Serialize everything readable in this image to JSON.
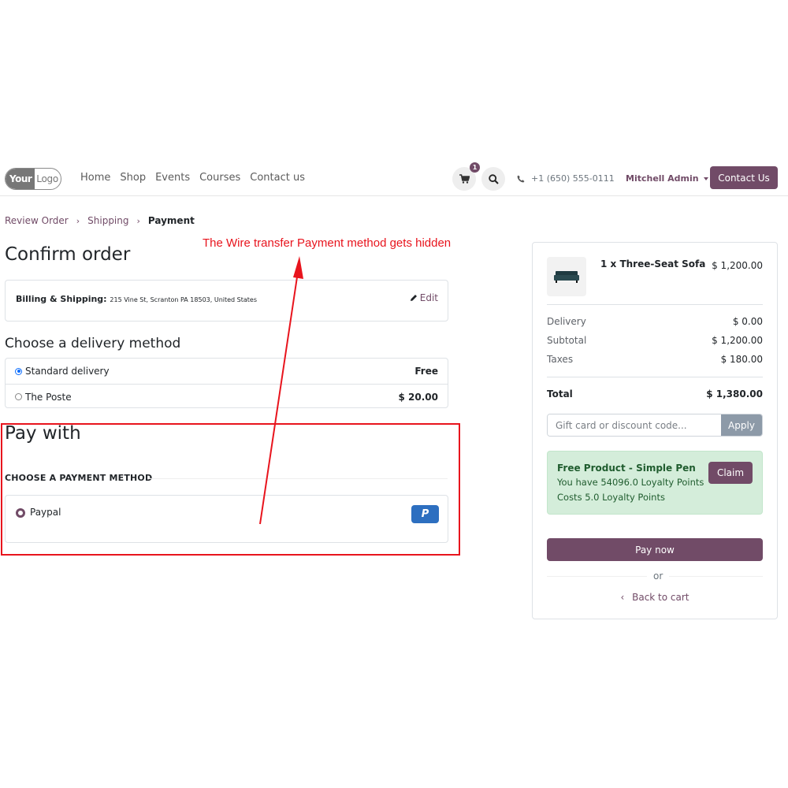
{
  "nav": {
    "logo_part1": "Your",
    "logo_part2": "Logo",
    "links": [
      "Home",
      "Shop",
      "Events",
      "Courses",
      "Contact us"
    ],
    "cart_count": "1",
    "phone": "+1 (650) 555-0111",
    "user": "Mitchell Admin",
    "contact_button": "Contact Us"
  },
  "breadcrumb": {
    "items": [
      "Review Order",
      "Shipping",
      "Payment"
    ],
    "separator": "›"
  },
  "annotation": "The Wire transfer Payment method gets hidden",
  "page_title": "Confirm order",
  "billing": {
    "label": "Billing & Shipping:",
    "address": "215 Vine St, Scranton PA 18503, United States",
    "edit": "Edit"
  },
  "delivery": {
    "title": "Choose a delivery method",
    "options": [
      {
        "label": "Standard delivery",
        "price": "Free",
        "selected": true
      },
      {
        "label": "The Poste",
        "price": "$ 20.00",
        "selected": false
      }
    ]
  },
  "payment": {
    "title": "Pay with",
    "header": "CHOOSE A PAYMENT METHOD",
    "method": "Paypal",
    "logo_glyph": "P"
  },
  "summary": {
    "product_name": "1 x Three-Seat Sofa",
    "product_price": "$ 1,200.00",
    "delivery_label": "Delivery",
    "delivery_value": "$ 0.00",
    "subtotal_label": "Subtotal",
    "subtotal_value": "$ 1,200.00",
    "taxes_label": "Taxes",
    "taxes_value": "$ 180.00",
    "total_label": "Total",
    "total_value": "$ 1,380.00",
    "promo_placeholder": "Gift card or discount code...",
    "apply": "Apply",
    "reward_title": "Free Product - Simple Pen",
    "reward_points": "You have 54096.0 Loyalty Points",
    "reward_cost": "Costs 5.0 Loyalty Points",
    "claim": "Claim",
    "pay_now": "Pay now",
    "or": "or",
    "back_to_cart": "Back to cart",
    "back_glyph": "‹"
  },
  "colors": {
    "brand": "#714b67",
    "annotation_red": "#e8141d",
    "reward_bg": "#d4edda",
    "paypal_blue": "#2d6fc0"
  }
}
